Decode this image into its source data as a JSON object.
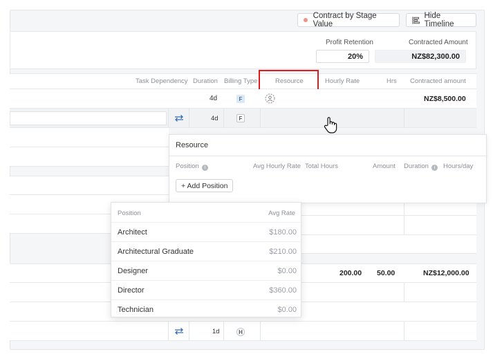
{
  "toolbar": {
    "contract_by_stage": "Contract by Stage Value",
    "hide_timeline": "Hide Timeline"
  },
  "summary": {
    "profit_retention_label": "Profit Retention",
    "profit_retention_value": "20%",
    "contracted_amount_label": "Contracted Amount",
    "contracted_amount_value": "NZ$82,300.00"
  },
  "table": {
    "headers": {
      "task_dependency": "Task Dependency",
      "duration": "Duration",
      "billing_type": "Billing Type",
      "resource": "Resource",
      "hourly_rate": "Hourly Rate",
      "hrs": "Hrs",
      "contracted_amount": "Contracted amount"
    },
    "stage1": {
      "duration": "4d",
      "billing": "F",
      "amount": "NZ$8,500.00"
    },
    "task1": {
      "duration": "4d",
      "billing": "F"
    },
    "stage2": {
      "hourly_rate": "200.00",
      "hrs": "50.00",
      "amount": "NZ$12,000.00"
    },
    "task_last": {
      "duration": "1d",
      "billing": "H"
    }
  },
  "resource_popup": {
    "title": "Resource",
    "col_position": "Position",
    "col_avg_hourly_rate": "Avg Hourly Rate",
    "col_total_hours": "Total Hours",
    "col_amount": "Amount",
    "col_duration": "Duration",
    "col_hours_day": "Hours/day",
    "add_position": "+ Add Position"
  },
  "position_dropdown": {
    "col_position": "Position",
    "col_avg_rate": "Avg Rate",
    "items": [
      {
        "name": "Architect",
        "rate": "$180.00"
      },
      {
        "name": "Architectural Graduate",
        "rate": "$210.00"
      },
      {
        "name": "Designer",
        "rate": "$0.00"
      },
      {
        "name": "Director",
        "rate": "$360.00"
      },
      {
        "name": "Technician",
        "rate": "$0.00"
      }
    ]
  },
  "colors": {
    "highlight": "#e3191c",
    "dot": "#f0928a",
    "sync_icon": "#3a6fb0"
  },
  "icons": [
    "dot-icon",
    "timeline-icon",
    "sync-icon",
    "user-circle-icon",
    "info-icon",
    "hand-cursor-icon"
  ]
}
